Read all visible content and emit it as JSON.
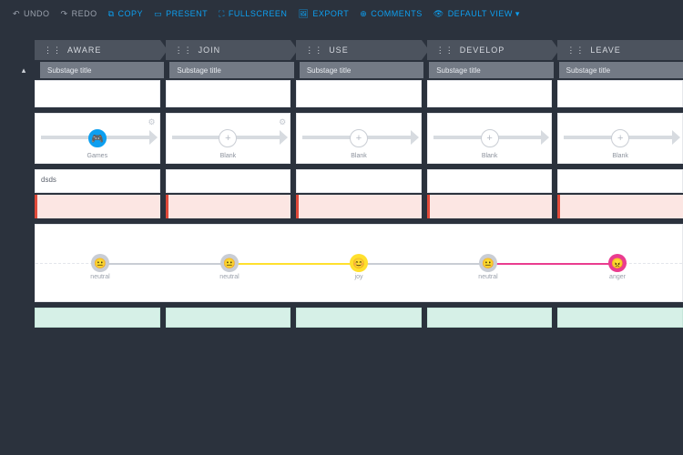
{
  "toolbar": {
    "undo": "UNDO",
    "redo": "REDO",
    "copy": "COPY",
    "present": "PRESENT",
    "fullscreen": "FULLSCREEN",
    "export": "EXPORT",
    "comments": "COMMENTS",
    "default_view": "DEFAULT VIEW ▾"
  },
  "stages": [
    "AWARE",
    "JOIN",
    "USE",
    "DEVELOP",
    "LEAVE"
  ],
  "substage_label": "Substage title",
  "touchpoints": [
    {
      "label": "Games",
      "icon": "gamepad",
      "primary": true
    },
    {
      "label": "Blank",
      "icon": "plus",
      "primary": false
    },
    {
      "label": "Blank",
      "icon": "plus",
      "primary": false
    },
    {
      "label": "Blank",
      "icon": "plus",
      "primary": false
    },
    {
      "label": "Blank",
      "icon": "plus",
      "primary": false
    }
  ],
  "text_row": [
    "dsds",
    "",
    "",
    "",
    ""
  ],
  "emotions": [
    {
      "pos": 10,
      "mood": "neutral",
      "label": "neutral",
      "bg": "#c9cdd4",
      "face": "😐"
    },
    {
      "pos": 30,
      "mood": "neutral",
      "label": "neutral",
      "bg": "#c9cdd4",
      "face": "😐"
    },
    {
      "pos": 50,
      "mood": "joy",
      "label": "joy",
      "bg": "#ffe02e",
      "face": "😊"
    },
    {
      "pos": 70,
      "mood": "neutral",
      "label": "neutral",
      "bg": "#c9cdd4",
      "face": "😐"
    },
    {
      "pos": 90,
      "mood": "anger",
      "label": "anger",
      "bg": "#ea3c8f",
      "face": "😠"
    }
  ],
  "emotion_segments": [
    {
      "from": 10,
      "to": 30,
      "color": "#c9cdd4"
    },
    {
      "from": 30,
      "to": 50,
      "color": "#ffe02e"
    },
    {
      "from": 50,
      "to": 70,
      "color": "#c9cdd4"
    },
    {
      "from": 70,
      "to": 90,
      "color": "#ea3c8f"
    }
  ],
  "colors": {
    "accent": "#0d9ff0",
    "bg": "#2b323d"
  }
}
